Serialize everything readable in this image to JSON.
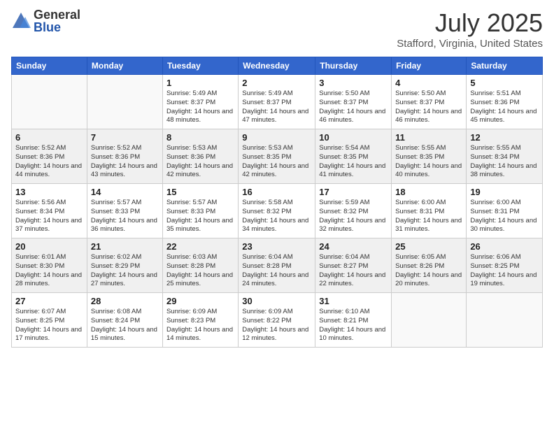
{
  "header": {
    "logo_general": "General",
    "logo_blue": "Blue",
    "month_title": "July 2025",
    "subtitle": "Stafford, Virginia, United States"
  },
  "weekdays": [
    "Sunday",
    "Monday",
    "Tuesday",
    "Wednesday",
    "Thursday",
    "Friday",
    "Saturday"
  ],
  "weeks": [
    [
      {
        "day": "",
        "info": ""
      },
      {
        "day": "",
        "info": ""
      },
      {
        "day": "1",
        "info": "Sunrise: 5:49 AM\nSunset: 8:37 PM\nDaylight: 14 hours and 48 minutes."
      },
      {
        "day": "2",
        "info": "Sunrise: 5:49 AM\nSunset: 8:37 PM\nDaylight: 14 hours and 47 minutes."
      },
      {
        "day": "3",
        "info": "Sunrise: 5:50 AM\nSunset: 8:37 PM\nDaylight: 14 hours and 46 minutes."
      },
      {
        "day": "4",
        "info": "Sunrise: 5:50 AM\nSunset: 8:37 PM\nDaylight: 14 hours and 46 minutes."
      },
      {
        "day": "5",
        "info": "Sunrise: 5:51 AM\nSunset: 8:36 PM\nDaylight: 14 hours and 45 minutes."
      }
    ],
    [
      {
        "day": "6",
        "info": "Sunrise: 5:52 AM\nSunset: 8:36 PM\nDaylight: 14 hours and 44 minutes."
      },
      {
        "day": "7",
        "info": "Sunrise: 5:52 AM\nSunset: 8:36 PM\nDaylight: 14 hours and 43 minutes."
      },
      {
        "day": "8",
        "info": "Sunrise: 5:53 AM\nSunset: 8:36 PM\nDaylight: 14 hours and 42 minutes."
      },
      {
        "day": "9",
        "info": "Sunrise: 5:53 AM\nSunset: 8:35 PM\nDaylight: 14 hours and 42 minutes."
      },
      {
        "day": "10",
        "info": "Sunrise: 5:54 AM\nSunset: 8:35 PM\nDaylight: 14 hours and 41 minutes."
      },
      {
        "day": "11",
        "info": "Sunrise: 5:55 AM\nSunset: 8:35 PM\nDaylight: 14 hours and 40 minutes."
      },
      {
        "day": "12",
        "info": "Sunrise: 5:55 AM\nSunset: 8:34 PM\nDaylight: 14 hours and 38 minutes."
      }
    ],
    [
      {
        "day": "13",
        "info": "Sunrise: 5:56 AM\nSunset: 8:34 PM\nDaylight: 14 hours and 37 minutes."
      },
      {
        "day": "14",
        "info": "Sunrise: 5:57 AM\nSunset: 8:33 PM\nDaylight: 14 hours and 36 minutes."
      },
      {
        "day": "15",
        "info": "Sunrise: 5:57 AM\nSunset: 8:33 PM\nDaylight: 14 hours and 35 minutes."
      },
      {
        "day": "16",
        "info": "Sunrise: 5:58 AM\nSunset: 8:32 PM\nDaylight: 14 hours and 34 minutes."
      },
      {
        "day": "17",
        "info": "Sunrise: 5:59 AM\nSunset: 8:32 PM\nDaylight: 14 hours and 32 minutes."
      },
      {
        "day": "18",
        "info": "Sunrise: 6:00 AM\nSunset: 8:31 PM\nDaylight: 14 hours and 31 minutes."
      },
      {
        "day": "19",
        "info": "Sunrise: 6:00 AM\nSunset: 8:31 PM\nDaylight: 14 hours and 30 minutes."
      }
    ],
    [
      {
        "day": "20",
        "info": "Sunrise: 6:01 AM\nSunset: 8:30 PM\nDaylight: 14 hours and 28 minutes."
      },
      {
        "day": "21",
        "info": "Sunrise: 6:02 AM\nSunset: 8:29 PM\nDaylight: 14 hours and 27 minutes."
      },
      {
        "day": "22",
        "info": "Sunrise: 6:03 AM\nSunset: 8:28 PM\nDaylight: 14 hours and 25 minutes."
      },
      {
        "day": "23",
        "info": "Sunrise: 6:04 AM\nSunset: 8:28 PM\nDaylight: 14 hours and 24 minutes."
      },
      {
        "day": "24",
        "info": "Sunrise: 6:04 AM\nSunset: 8:27 PM\nDaylight: 14 hours and 22 minutes."
      },
      {
        "day": "25",
        "info": "Sunrise: 6:05 AM\nSunset: 8:26 PM\nDaylight: 14 hours and 20 minutes."
      },
      {
        "day": "26",
        "info": "Sunrise: 6:06 AM\nSunset: 8:25 PM\nDaylight: 14 hours and 19 minutes."
      }
    ],
    [
      {
        "day": "27",
        "info": "Sunrise: 6:07 AM\nSunset: 8:25 PM\nDaylight: 14 hours and 17 minutes."
      },
      {
        "day": "28",
        "info": "Sunrise: 6:08 AM\nSunset: 8:24 PM\nDaylight: 14 hours and 15 minutes."
      },
      {
        "day": "29",
        "info": "Sunrise: 6:09 AM\nSunset: 8:23 PM\nDaylight: 14 hours and 14 minutes."
      },
      {
        "day": "30",
        "info": "Sunrise: 6:09 AM\nSunset: 8:22 PM\nDaylight: 14 hours and 12 minutes."
      },
      {
        "day": "31",
        "info": "Sunrise: 6:10 AM\nSunset: 8:21 PM\nDaylight: 14 hours and 10 minutes."
      },
      {
        "day": "",
        "info": ""
      },
      {
        "day": "",
        "info": ""
      }
    ]
  ]
}
